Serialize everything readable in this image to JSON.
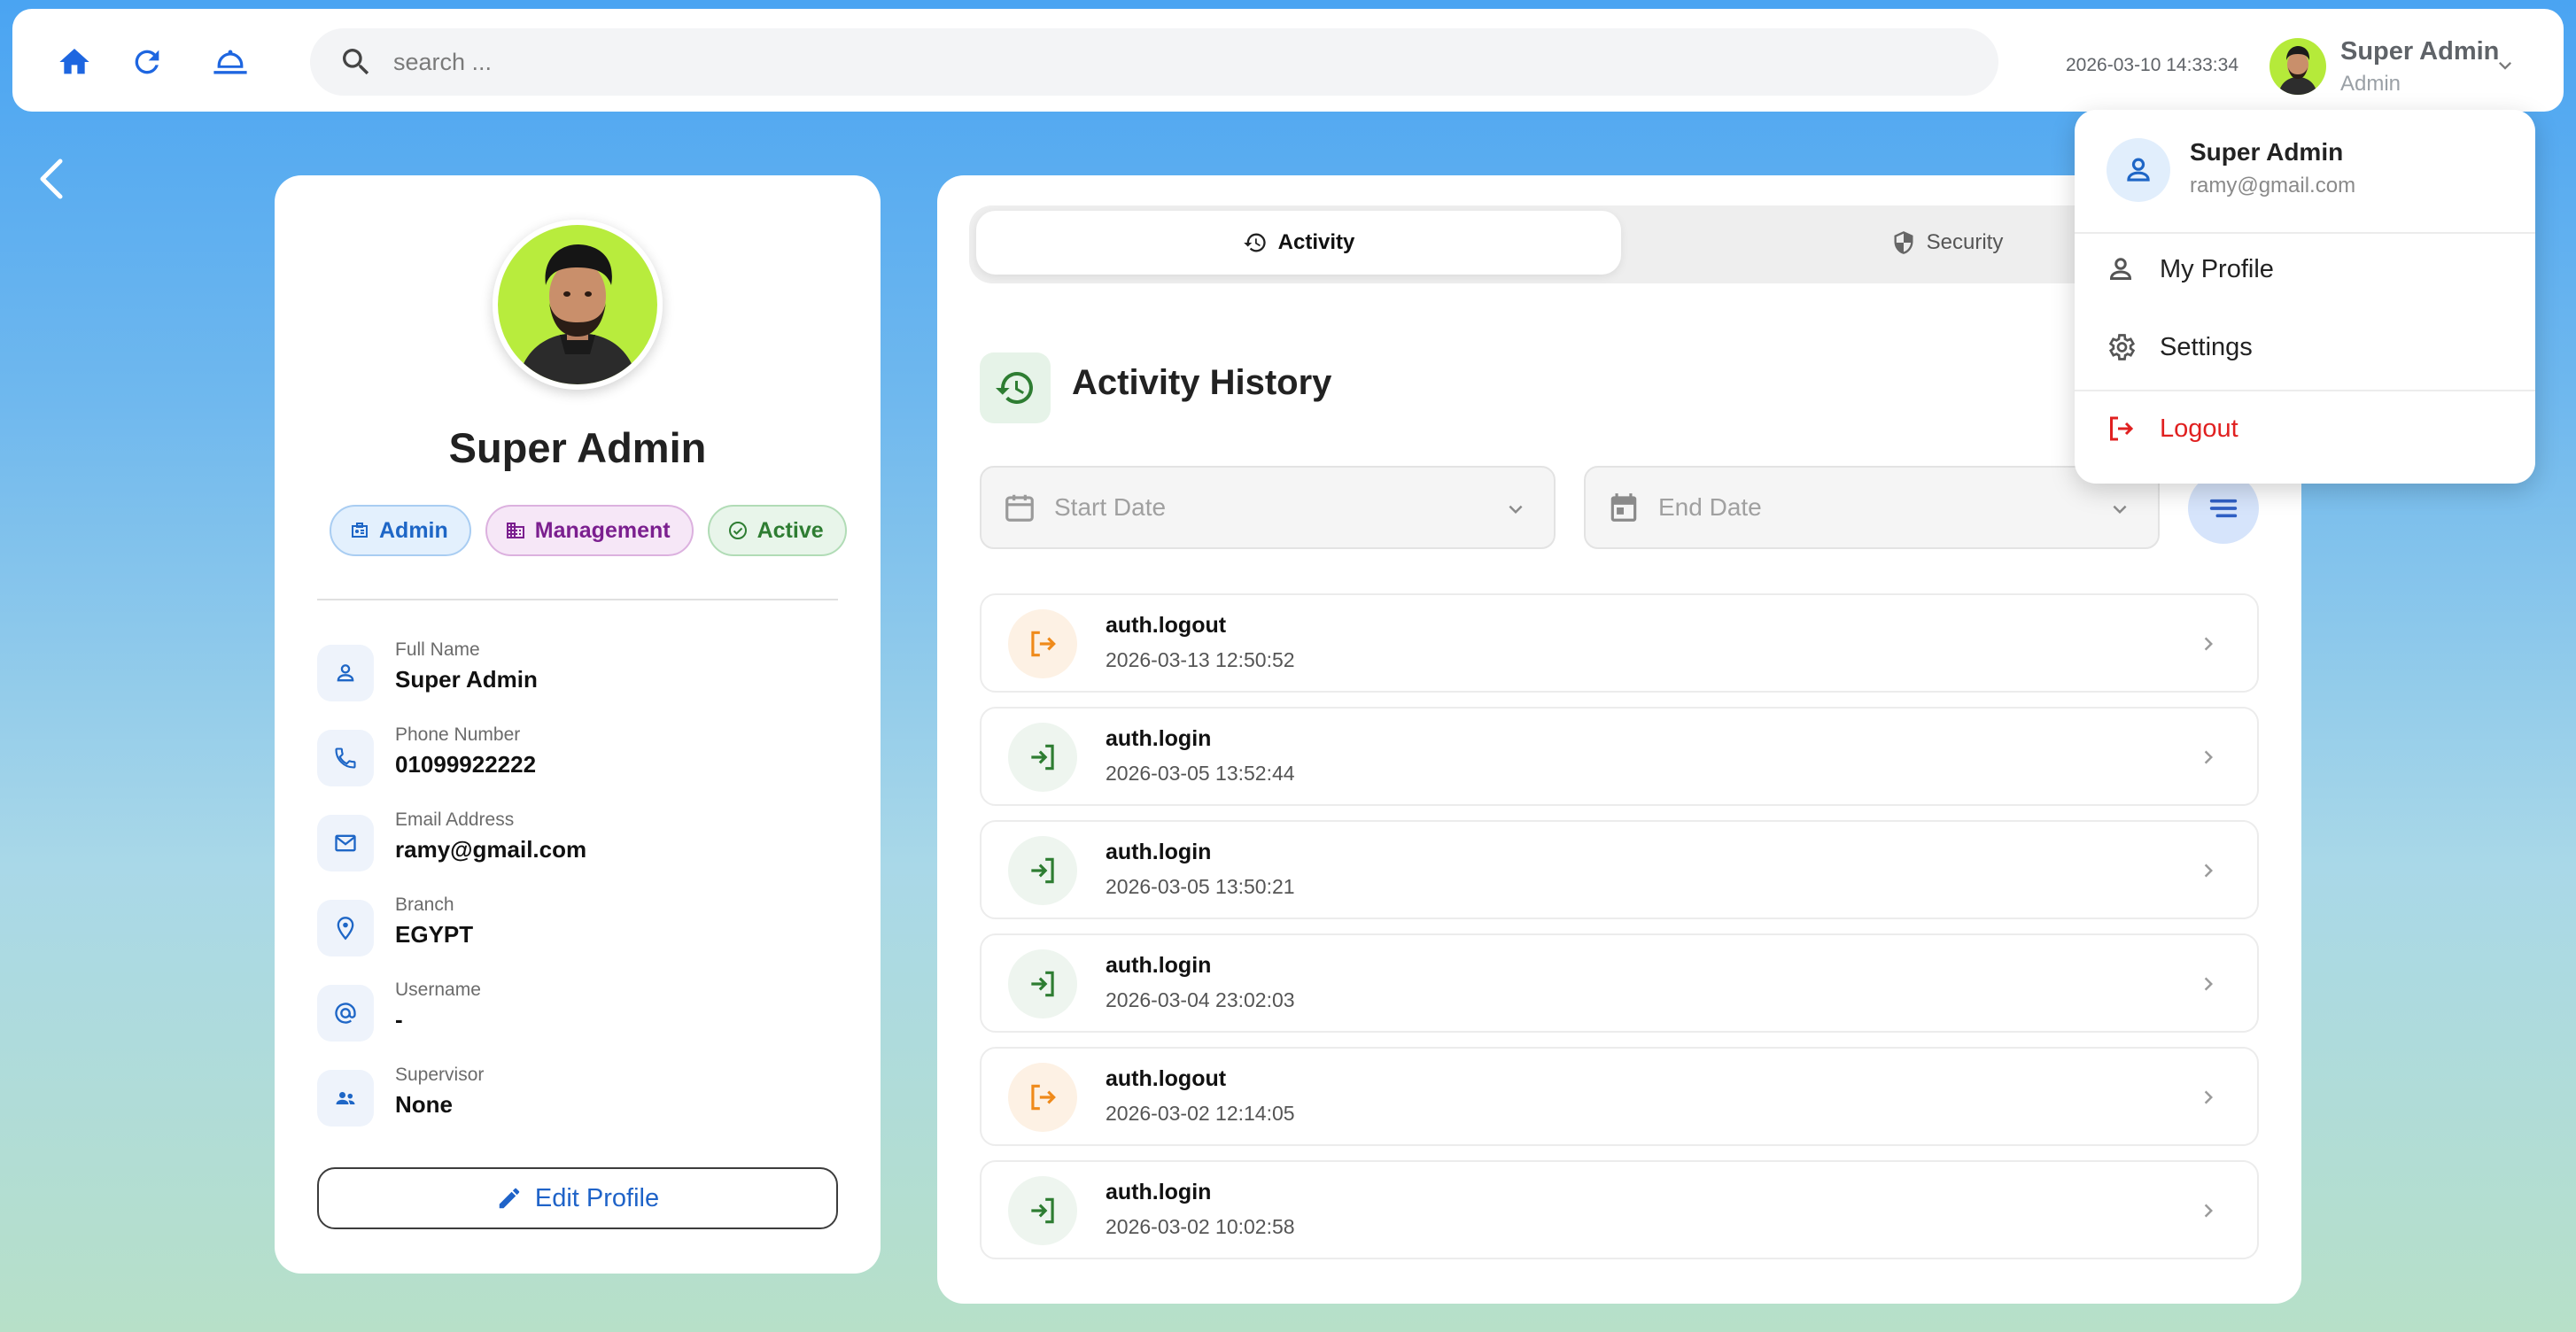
{
  "topbar": {
    "icons": [
      "home-icon",
      "refresh-icon",
      "service-bell-icon"
    ],
    "search_placeholder": "search ...",
    "datetime": "2026-03-10 14:33:34",
    "user": {
      "name": "Super Admin",
      "role": "Admin"
    }
  },
  "profile": {
    "name": "Super Admin",
    "chips": [
      {
        "label": "Admin",
        "color": "#1e66c6"
      },
      {
        "label": "Management",
        "color": "#7b1f8f"
      },
      {
        "label": "Active",
        "color": "#2e7d32"
      }
    ],
    "fields": [
      {
        "label": "Full Name",
        "value": "Super Admin",
        "icon": "person-icon"
      },
      {
        "label": "Phone Number",
        "value": "01099922222",
        "icon": "phone-icon"
      },
      {
        "label": "Email Address",
        "value": "ramy@gmail.com",
        "icon": "mail-icon"
      },
      {
        "label": "Branch",
        "value": "EGYPT",
        "icon": "location-pin-icon"
      },
      {
        "label": "Username",
        "value": "-",
        "icon": "at-sign-icon"
      },
      {
        "label": "Supervisor",
        "value": "None",
        "icon": "people-icon"
      }
    ],
    "edit_label": "Edit Profile"
  },
  "tabs": [
    {
      "label": "Activity",
      "active": true
    },
    {
      "label": "Security",
      "active": false
    }
  ],
  "activity": {
    "title": "Activity History",
    "start_date_label": "Start Date",
    "end_date_label": "End Date",
    "items": [
      {
        "action": "auth.logout",
        "time": "2026-03-13 12:50:52",
        "kind": "logout"
      },
      {
        "action": "auth.login",
        "time": "2026-03-05 13:52:44",
        "kind": "login"
      },
      {
        "action": "auth.login",
        "time": "2026-03-05 13:50:21",
        "kind": "login"
      },
      {
        "action": "auth.login",
        "time": "2026-03-04 23:02:03",
        "kind": "login"
      },
      {
        "action": "auth.logout",
        "time": "2026-03-02 12:14:05",
        "kind": "logout"
      },
      {
        "action": "auth.login",
        "time": "2026-03-02 10:02:58",
        "kind": "login"
      }
    ]
  },
  "user_menu": {
    "name": "Super Admin",
    "email": "ramy@gmail.com",
    "items": [
      {
        "label": "My Profile",
        "icon": "person-icon"
      },
      {
        "label": "Settings",
        "icon": "gear-icon"
      },
      {
        "label": "Logout",
        "icon": "logout-icon"
      }
    ]
  },
  "colors": {
    "primary": "#1e66c6",
    "login": "#2e7d32",
    "logout": "#ef8a1a",
    "danger": "#e02020"
  }
}
